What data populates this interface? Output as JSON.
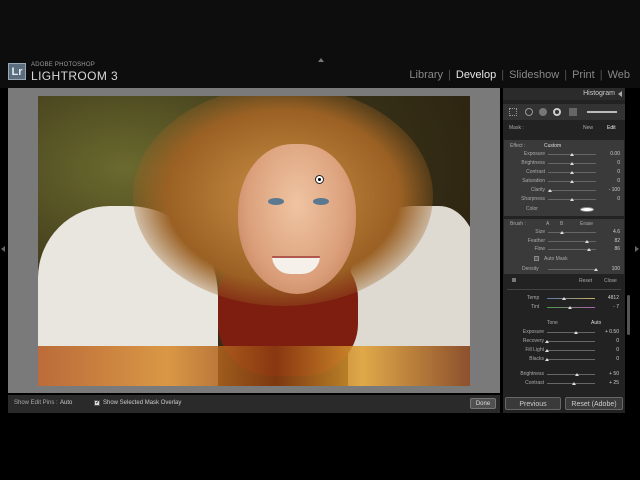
{
  "app": {
    "brand_small": "ADOBE PHOTOSHOP",
    "brand_big": "LIGHTROOM 3",
    "badge": "Lr"
  },
  "modules": [
    {
      "label": "Library",
      "active": false
    },
    {
      "label": "Develop",
      "active": true
    },
    {
      "label": "Slideshow",
      "active": false
    },
    {
      "label": "Print",
      "active": false
    },
    {
      "label": "Web",
      "active": false
    }
  ],
  "toolbar": {
    "show_edit_pins_label": "Show Edit Pins :",
    "show_edit_pins_value": "Auto",
    "overlay_checked": true,
    "overlay_label": "Show Selected Mask Overlay",
    "done_label": "Done"
  },
  "panel": {
    "histogram_title": "Histogram",
    "mask_label": "Mask :",
    "mask_new": "New",
    "mask_edit": "Edit",
    "effect_label": "Effect :",
    "effect_value": "Custom",
    "effects": [
      {
        "label": "Exposure",
        "value": "0.00",
        "level": 0.5
      },
      {
        "label": "Brightness",
        "value": "0",
        "level": 0.5
      },
      {
        "label": "Contrast",
        "value": "0",
        "level": 0.5
      },
      {
        "label": "Saturation",
        "value": "0",
        "level": 0.5
      },
      {
        "label": "Clarity",
        "value": "- 100",
        "level": 0.05
      },
      {
        "label": "Sharpness",
        "value": "0",
        "level": 0.5
      }
    ],
    "color_label": "Color",
    "brush_label": "Brush :",
    "brush_a": "A",
    "brush_b": "B",
    "brush_erase": "Erase",
    "brush": [
      {
        "label": "Size",
        "value": "4.6",
        "level": 0.3
      },
      {
        "label": "Feather",
        "value": "82",
        "level": 0.82
      },
      {
        "label": "Flow",
        "value": "86",
        "level": 0.86
      }
    ],
    "auto_mask_label": "Auto Mask",
    "density_label": "Density",
    "density_value": "100",
    "density_level": 1.0,
    "reset_label": "Reset",
    "close_label": "Close",
    "temp_label": "Temp",
    "temp_value": "4812",
    "temp_level": 0.35,
    "tint_label": "Tint",
    "tint_value": "- 7",
    "tint_level": 0.47,
    "tone_label": "Tone",
    "tone_auto": "Auto",
    "tone": [
      {
        "label": "Exposure",
        "value": "+ 0.50",
        "level": 0.6
      },
      {
        "label": "Recovery",
        "value": "0",
        "level": 0.0
      },
      {
        "label": "Fill Light",
        "value": "0",
        "level": 0.0
      },
      {
        "label": "Blacks",
        "value": "0",
        "level": 0.0
      }
    ],
    "presence": [
      {
        "label": "Brightness",
        "value": "+ 50",
        "level": 0.62
      },
      {
        "label": "Contrast",
        "value": "+ 25",
        "level": 0.56
      }
    ]
  },
  "buttons": {
    "previous": "Previous",
    "reset_adobe": "Reset (Adobe)"
  }
}
